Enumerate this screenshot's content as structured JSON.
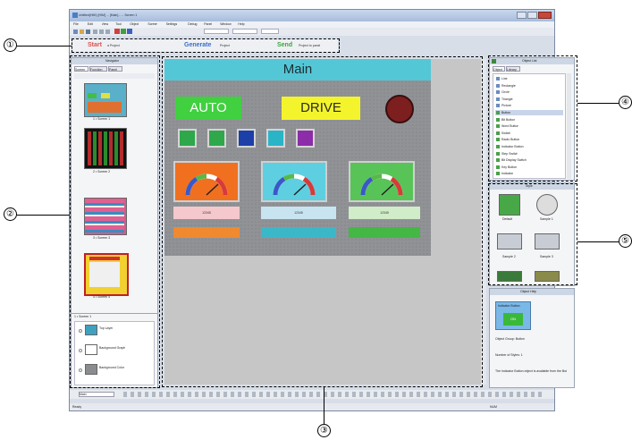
{
  "window": {
    "title": "Untitled(HMI) [HIM] ... [Main] - ... Screen 1",
    "menu": [
      "File",
      "Edit",
      "View",
      "Tool",
      "Object",
      "Screen",
      "Settings",
      "Debug",
      "Panel",
      "Window",
      "Help"
    ]
  },
  "steps": {
    "step1": "Start",
    "step1_label": "a Project",
    "step2": "Generate",
    "step2_label": "Project",
    "step3": "Send",
    "step3_label": "Project to panel"
  },
  "navigator": {
    "title": "Navigator",
    "tabs": [
      "Screen",
      "Function",
      "Panel"
    ],
    "screens": [
      {
        "caption": "1 • Screen 1"
      },
      {
        "caption": "2 • Screen 2"
      },
      {
        "caption": "3 • Screen 3"
      },
      {
        "caption": "4 • Screen 4"
      }
    ],
    "bottom_title": "1 • Screen 1",
    "layers": [
      "Top Layer",
      "Background Graph",
      "Background Color"
    ]
  },
  "canvas": {
    "screen_title": "Main",
    "auto_label": "AUTO",
    "drive_label": "DRIVE",
    "gauge_values": [
      "12345",
      "12345",
      "12345"
    ],
    "gauge_colors": [
      "#f07020",
      "#5ecfe0",
      "#58c458"
    ],
    "square_colors": [
      "#2ea84a",
      "#2ea84a",
      "#1c3fa8",
      "#2ab4c8",
      "#8c2ca8"
    ]
  },
  "object_list": {
    "title": "Object List",
    "tabs": [
      "Object",
      "Library"
    ],
    "items": [
      "Line",
      "Rectangle",
      "Circle",
      "Triangle",
      "Picture",
      "Button",
      "Bit Button",
      "Word Button",
      "Switch",
      "Radio Button",
      "Indicator Button",
      "Step Switch",
      "Bit Display Switch",
      "Key Button",
      "Indicator"
    ]
  },
  "styles_panel": {
    "title": "Style",
    "items": [
      "Default",
      "Sample 1",
      "Sample 2",
      "Sample 3",
      "Sample 4",
      "Sample 5"
    ]
  },
  "object_help": {
    "title": "Object Help",
    "preview_caption": "Indicator Button",
    "preview_label": "ON",
    "text1": "Object Group: Button",
    "text2": "Number of Styles: 1",
    "text3": "The Indicator Button object is available from the Button..."
  },
  "bottom_bar": {
    "screen_field": "Main"
  },
  "status": {
    "left": "Ready",
    "right": "NUM"
  },
  "callouts": [
    "①",
    "②",
    "③",
    "④",
    "⑤"
  ]
}
